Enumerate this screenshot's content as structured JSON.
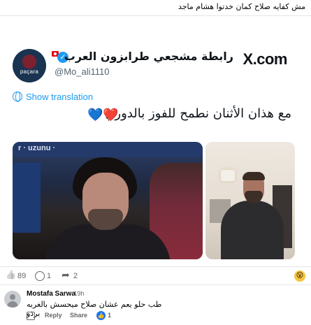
{
  "post": {
    "caption": "مش كفايه صلاح كمان خدتوا هشام ماجد"
  },
  "tweet": {
    "avatar_text": "paçara",
    "display_name": "رابطة مشجعي طرابزون العرب",
    "username": "@Mo_ali1110",
    "source": "X.com",
    "translate_label": "Show translation",
    "text": "مع هذان الأثنان نطمح للفوز بالدوري",
    "hearts": "💙❤️",
    "banner_text": "r  ·  uzunu  ·  "
  },
  "reactions": {
    "likes": "89",
    "comments": "1",
    "shares": "2",
    "emoji": "😮"
  },
  "comment": {
    "author": "Mostafa Sarwa",
    "time": "19h",
    "text": "طب حلو يعم عشان صلاح ميحسش بالغربه برذو",
    "reply_label": "Reply",
    "share_label": "Share",
    "like_count": "1"
  }
}
